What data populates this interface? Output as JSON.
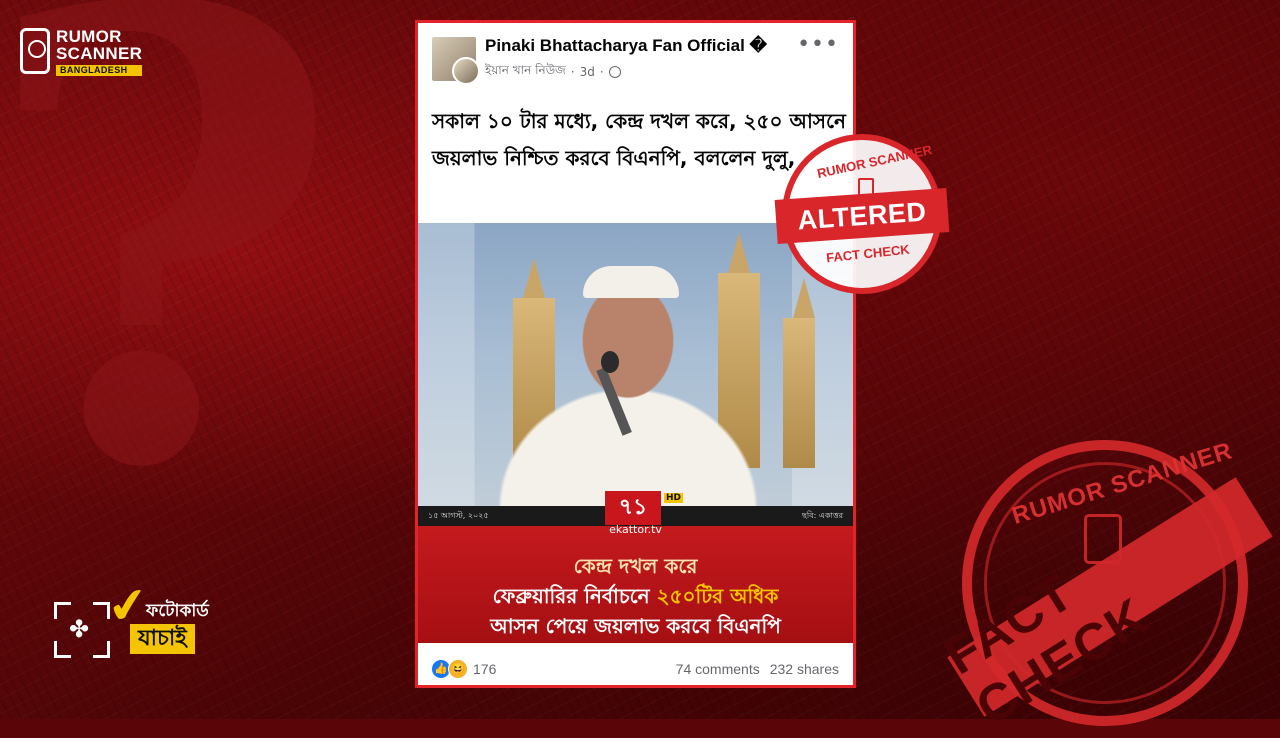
{
  "brand": {
    "line1": "RUMOR",
    "line2": "SCANNER",
    "sub": "BANGLADESH"
  },
  "photocard": {
    "label1": "ফটোকার্ড",
    "label2": "যাচাই"
  },
  "post": {
    "page_name": "Pinaki Bhattacharya Fan Official �",
    "meta_author": "ইয়ান খান নিউজ",
    "meta_time": "3d",
    "caption": "সকাল ১০ টার মধ্যে, কেন্দ্র দখল করে, ২৫০ আসনে জয়লাভ নিশ্চিত করবে বিএনপি, বললেন দুলু,",
    "reactions": "176",
    "comments": "74 comments",
    "shares": "232 shares"
  },
  "media": {
    "logo": "৭১",
    "logo_badge": "HD",
    "logo_url": "ekattor.tv",
    "date_left": "১৫ আগস্ট, ২০২৫",
    "date_right": "ছবি: একাত্তর",
    "line1": "কেন্দ্র দখল করে",
    "line2_pre": "ফেব্রুয়ারির নির্বাচনে ",
    "line2_hl": "২৫০টির অধিক",
    "line3": "আসন পেয়ে জয়লাভ করবে বিএনপি"
  },
  "stamp_small": {
    "title": "RUMOR SCANNER",
    "band": "ALTERED",
    "sub": "FACT CHECK"
  },
  "stamp_big": {
    "title": "RUMOR SCANNER",
    "band": "FACT CHECK"
  },
  "colors": {
    "brand_red": "#d8262b",
    "brand_yellow": "#f5c400",
    "facebook_blue": "#1877f2"
  }
}
